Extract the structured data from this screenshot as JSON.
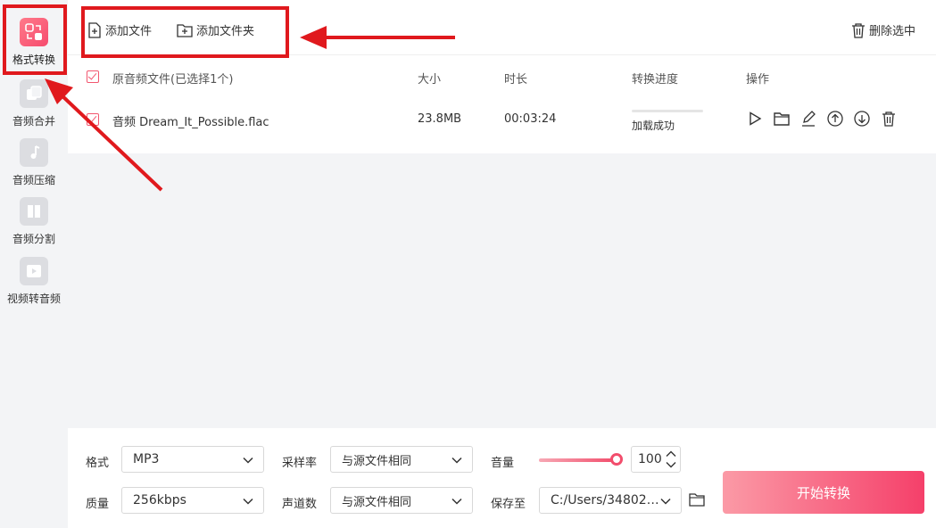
{
  "sidebar": {
    "items": [
      {
        "label": "格式转换",
        "icon": "format-convert-icon",
        "active": true
      },
      {
        "label": "音频合并",
        "icon": "audio-merge-icon"
      },
      {
        "label": "音频压缩",
        "icon": "audio-compress-icon"
      },
      {
        "label": "音频分割",
        "icon": "audio-split-icon"
      },
      {
        "label": "视频转音频",
        "icon": "video-to-audio-icon"
      }
    ]
  },
  "toolbar": {
    "add_file": "添加文件",
    "add_folder": "添加文件夹",
    "delete_selected": "删除选中"
  },
  "table": {
    "headers": {
      "file": "原音频文件(已选择1个)",
      "size": "大小",
      "duration": "时长",
      "progress": "转换进度",
      "actions": "操作"
    },
    "rows": [
      {
        "name": "音频 Dream_It_Possible.flac",
        "size": "23.8MB",
        "duration": "00:03:24",
        "status": "加载成功",
        "progress": 0,
        "checked": true
      }
    ]
  },
  "settings": {
    "format_label": "格式",
    "format_value": "MP3",
    "quality_label": "质量",
    "quality_value": "256kbps",
    "sample_rate_label": "采样率",
    "sample_rate_value": "与源文件相同",
    "channels_label": "声道数",
    "channels_value": "与源文件相同",
    "volume_label": "音量",
    "volume_value": "100",
    "save_label": "保存至",
    "save_path": "C:/Users/34802/..."
  },
  "start_button": "开始转换",
  "colors": {
    "accent": "#f24d6c",
    "annotation": "#e0191d"
  }
}
